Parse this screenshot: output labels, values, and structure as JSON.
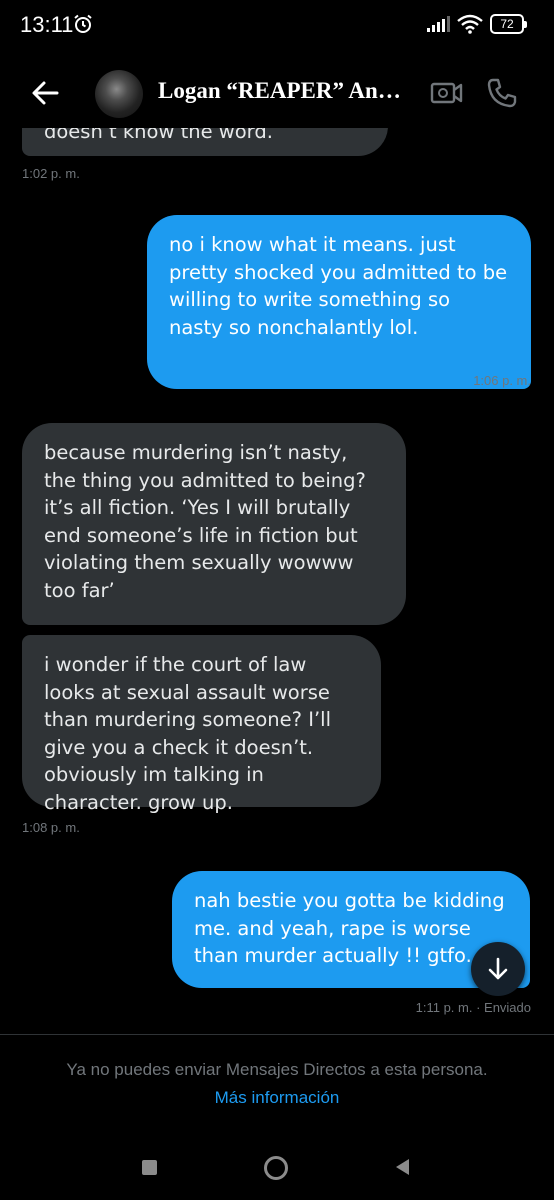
{
  "status_bar": {
    "time": "13:11",
    "battery": "72"
  },
  "header": {
    "contact_name": "Logan “REAPER” Anderson"
  },
  "messages": [
    {
      "id": "m0",
      "side": "received",
      "text": "doesn’t know the word."
    },
    {
      "id": "m1",
      "side": "sent",
      "text": "no i know what it means. just pretty shocked you admitted to be willing to write something so nasty so nonchalantly lol."
    },
    {
      "id": "m2",
      "side": "received",
      "text": "because murdering isn’t nasty, the thing you admitted to being? it’s all fiction. ‘Yes I will brutally end someone’s life in fiction but violating them sexually wowww too far’"
    },
    {
      "id": "m3",
      "side": "received",
      "text": "i wonder if the court of law looks at sexual assault worse than murdering someone? I’ll give you a check it doesn’t. obviously im talking in character. grow up."
    },
    {
      "id": "m4",
      "side": "sent",
      "text": "nah bestie you gotta be kidding me. and yeah, rape is worse than murder actually !! gtfo. 👍"
    }
  ],
  "timestamps": {
    "t0": "1:02 p. m.",
    "t1": "1:06 p. m.",
    "t3": "1:08 p. m.",
    "t4": "1:11 p. m. · Enviado"
  },
  "footer": {
    "notice": "Ya no puedes enviar Mensajes Directos a esta persona.",
    "link": "Más información"
  },
  "icons": [
    "alarm-icon",
    "signal-icon",
    "wifi-icon",
    "battery-icon",
    "back-arrow-icon",
    "video-call-icon",
    "phone-icon",
    "arrow-down-icon",
    "nav-recents-icon",
    "nav-home-icon",
    "nav-back-icon"
  ],
  "colors": {
    "background": "#000000",
    "sent_bubble": "#1d9bf0",
    "received_bubble": "#2f3336",
    "link": "#1d9bf0",
    "muted": "#71767b"
  }
}
